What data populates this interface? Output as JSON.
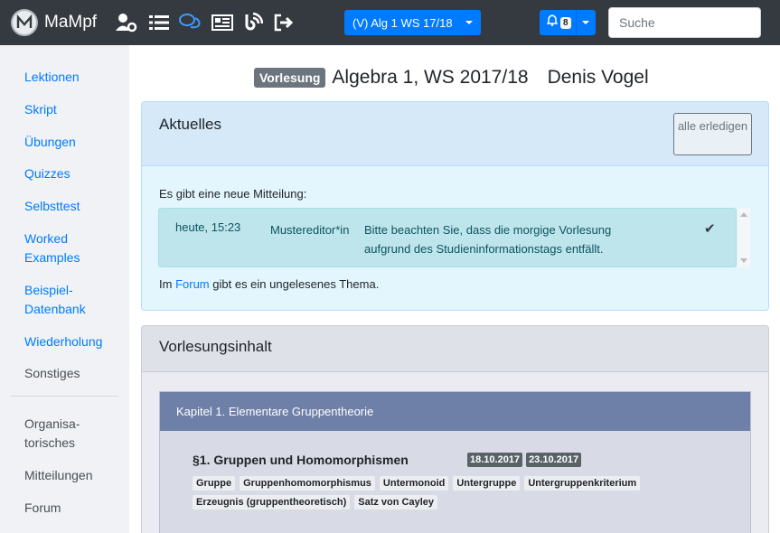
{
  "brand": {
    "name": "MaMpf",
    "logo_icon": "mampf-logo-icon"
  },
  "nav_icons": [
    "user-settings-icon",
    "list-icon",
    "comments-icon",
    "news-icon",
    "blog-icon",
    "logout-icon"
  ],
  "course_dropdown": {
    "label": "(V) Alg 1 WS 17/18"
  },
  "notifications": {
    "count": "8"
  },
  "search": {
    "placeholder": "Suche"
  },
  "sidebar": {
    "primary": [
      "Lektionen",
      "Skript",
      "Übungen",
      "Quizzes",
      "Selbsttest",
      "Worked Examples",
      "Beispiel-Datenbank",
      "Wiederholung"
    ],
    "primary_muted": "Sonstiges",
    "secondary": [
      "Organisa-torisches",
      "Mitteilungen",
      "Forum"
    ]
  },
  "header": {
    "badge": "Vorlesung",
    "title": "Algebra 1, WS 2017/18",
    "author": "Denis Vogel"
  },
  "news": {
    "title": "Aktuelles",
    "mark_all": "alle erledigen",
    "intro": "Es gibt eine neue Mitteilung:",
    "item": {
      "date": "heute, 15:23",
      "author": "Mustereditor*in",
      "message": "Bitte beachten Sie, dass die morgige Vorlesung aufgrund des Studieninformationstags entfällt."
    },
    "forum_prefix": "Im",
    "forum_link": "Forum",
    "forum_suffix": "gibt es ein ungelesenes Thema."
  },
  "content": {
    "title": "Vorlesungsinhalt",
    "chapter": "Kapitel 1. Elementare Gruppentheorie",
    "section": "§1. Gruppen und Homomorphismen",
    "dates": [
      "18.10.2017",
      "23.10.2017"
    ],
    "tags": [
      "Gruppe",
      "Gruppenhomomorphismus",
      "Untermonoid",
      "Untergruppe",
      "Untergruppenkriterium",
      "Erzeugnis (gruppentheoretisch)",
      "Satz von Cayley"
    ]
  }
}
